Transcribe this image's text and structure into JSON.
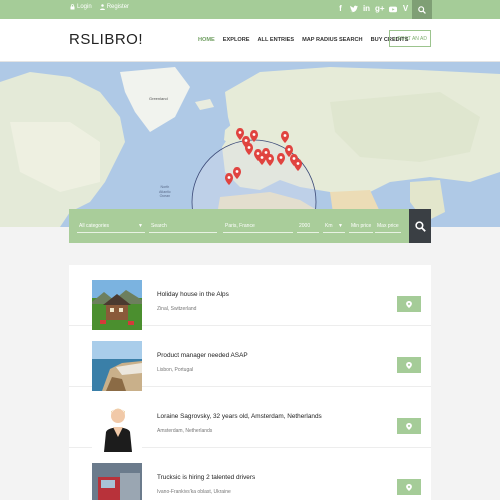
{
  "topbar": {
    "login": "Login",
    "register": "Register",
    "social_icons": [
      "facebook",
      "twitter",
      "linkedin",
      "google-plus",
      "youtube",
      "vimeo"
    ]
  },
  "header": {
    "logo": "RSLIBRO!",
    "nav": [
      "HOME",
      "EXPLORE",
      "ALL ENTRIES",
      "MAP RADIUS SEARCH",
      "BUY CREDITS"
    ],
    "post_ad": "+ POST AN AD"
  },
  "map": {
    "labels": {
      "greenland": "Greenland",
      "north_atlantic": "North\nAtlantic\nOcean"
    }
  },
  "search": {
    "category": "All categories",
    "keyword_placeholder": "Search",
    "location": "Paris, France",
    "radius": "2000",
    "unit": "Km",
    "min_price": "Min price",
    "max_price": "Max price"
  },
  "listings": [
    {
      "title": "Holiday house in the Alps",
      "location": "Zinal, Switzerland"
    },
    {
      "title": "Product manager needed ASAP",
      "location": "Lisbon, Portugal"
    },
    {
      "title": "Loraine Sagrovsky, 32 years old, Amsterdam, Netherlands",
      "location": "Amsterdam, Netherlands"
    },
    {
      "title": "Trucksic is hiring 2 talented drivers",
      "location": "Ivano-Frankivs'ka oblast, Ukraine"
    }
  ],
  "colors": {
    "accent": "#a5cc98",
    "accent_dark": "#7f9f75",
    "search_button": "#3a3f44"
  }
}
